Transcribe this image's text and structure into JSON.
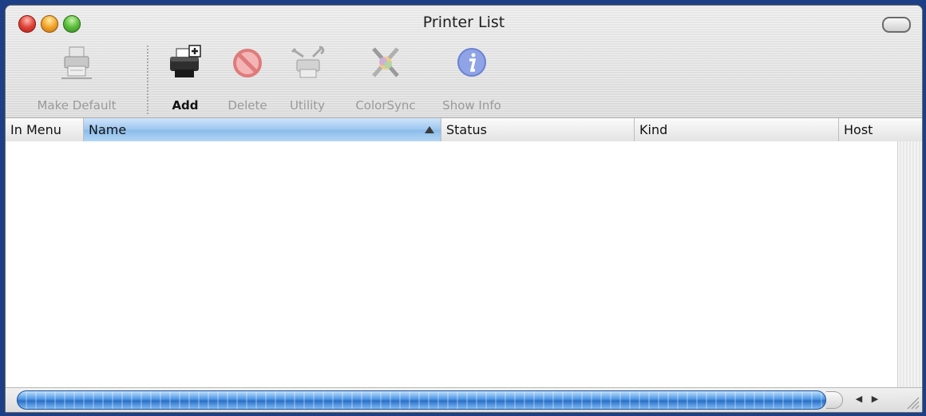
{
  "window": {
    "title": "Printer List"
  },
  "toolbar": {
    "items": [
      {
        "label": "Make Default",
        "icon": "make-default-printer-icon",
        "enabled": false
      },
      {
        "label": "Add",
        "icon": "add-printer-icon",
        "enabled": true
      },
      {
        "label": "Delete",
        "icon": "delete-icon",
        "enabled": false
      },
      {
        "label": "Utility",
        "icon": "utility-icon",
        "enabled": false
      },
      {
        "label": "ColorSync",
        "icon": "colorsync-icon",
        "enabled": false
      },
      {
        "label": "Show Info",
        "icon": "info-icon",
        "enabled": false
      }
    ]
  },
  "table": {
    "columns": [
      {
        "label": "In Menu"
      },
      {
        "label": "Name",
        "sorted": true,
        "sort": "ascending"
      },
      {
        "label": "Status"
      },
      {
        "label": "Kind"
      },
      {
        "label": "Host"
      }
    ],
    "rows": []
  },
  "colors": {
    "desktop": "#1d3f86",
    "sorted_header": "#9cc6ef",
    "scroll_thumb": "#4d95e3"
  }
}
